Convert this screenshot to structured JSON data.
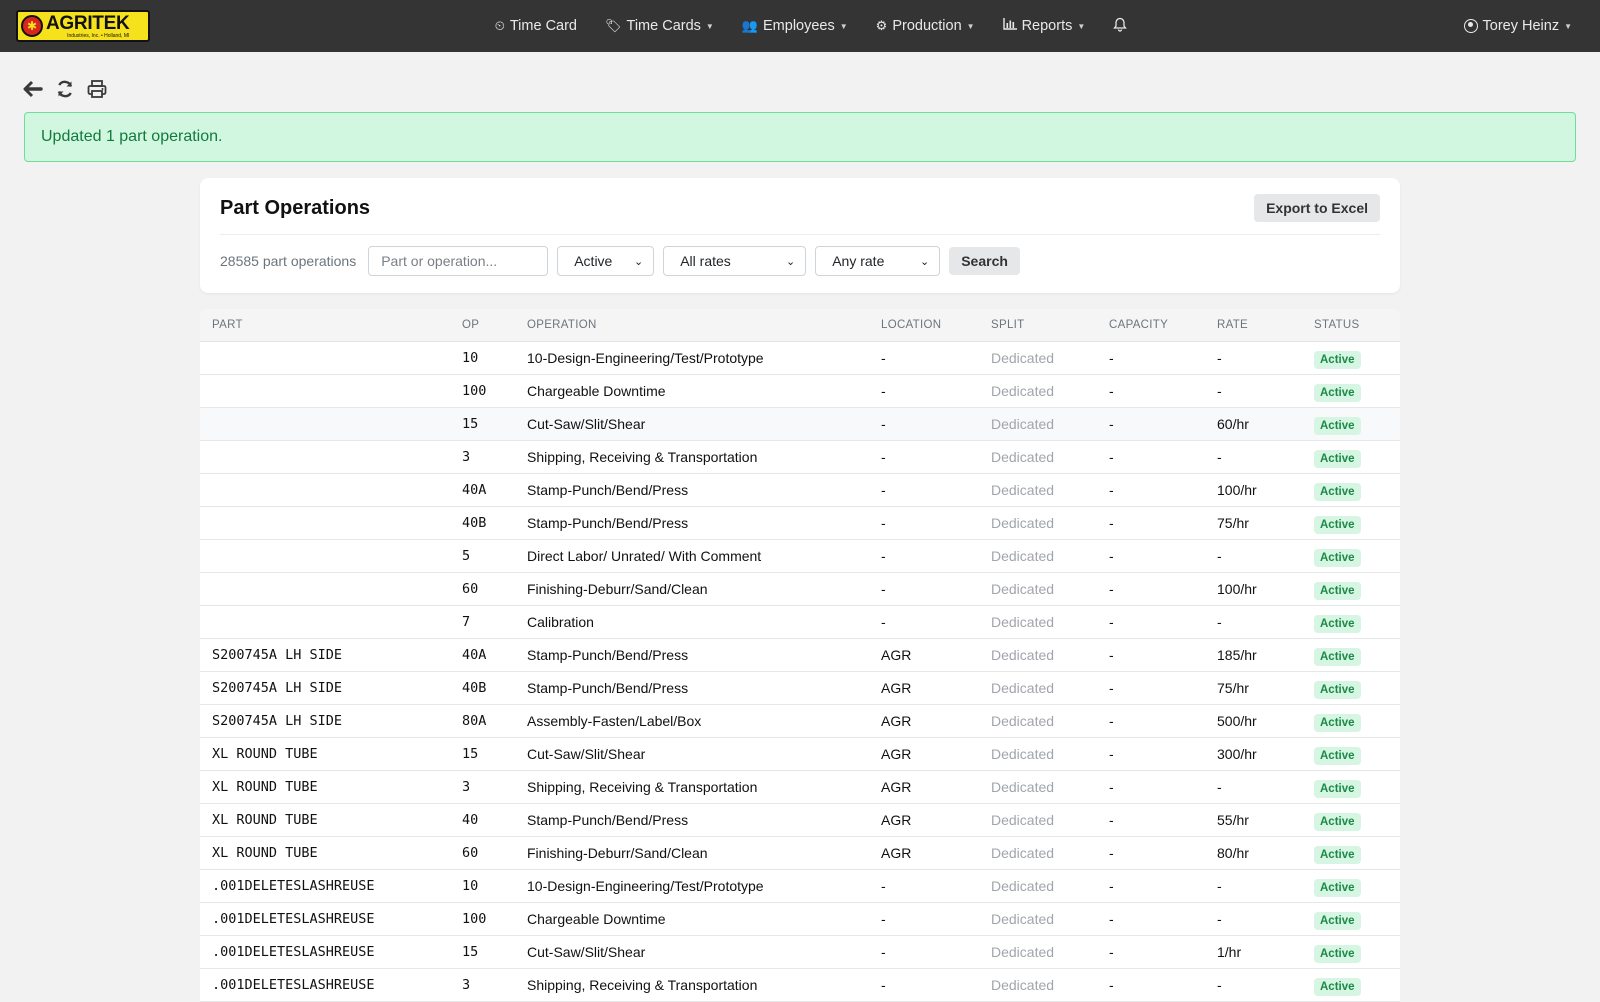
{
  "nav": {
    "logo_text": "AGRITEK",
    "logo_sub": "Industries, Inc. • Holland, MI",
    "items": [
      {
        "label": "Time Card",
        "icon": "clock-icon",
        "caret": false
      },
      {
        "label": "Time Cards",
        "icon": "tags-icon",
        "caret": true
      },
      {
        "label": "Employees",
        "icon": "users-icon",
        "caret": true
      },
      {
        "label": "Production",
        "icon": "cogs-icon",
        "caret": true
      },
      {
        "label": "Reports",
        "icon": "bar-chart-icon",
        "caret": true
      }
    ],
    "user": "Torey Heinz"
  },
  "toolbar": {
    "icons": [
      "back-arrow-icon",
      "refresh-icon",
      "print-icon"
    ]
  },
  "alert": {
    "message": "Updated 1 part operation."
  },
  "card": {
    "title": "Part Operations",
    "export_label": "Export to Excel",
    "count_text": "28585 part operations",
    "search_placeholder": "Part or operation...",
    "status_filter": "Active",
    "rates_filter": "All rates",
    "rate_filter": "Any rate",
    "search_label": "Search"
  },
  "table": {
    "headers": {
      "part": "PART",
      "op": "OP",
      "operation": "OPERATION",
      "location": "LOCATION",
      "split": "SPLIT",
      "capacity": "CAPACITY",
      "rate": "RATE",
      "status": "STATUS"
    },
    "rows": [
      {
        "part": "",
        "op": "10",
        "operation": "10-Design-Engineering/Test/Prototype",
        "location": "-",
        "split": "Dedicated",
        "capacity": "-",
        "rate": "-",
        "status": "Active"
      },
      {
        "part": "",
        "op": "100",
        "operation": "Chargeable Downtime",
        "location": "-",
        "split": "Dedicated",
        "capacity": "-",
        "rate": "-",
        "status": "Active"
      },
      {
        "part": "",
        "op": "15",
        "operation": "Cut-Saw/Slit/Shear",
        "location": "-",
        "split": "Dedicated",
        "capacity": "-",
        "rate": "60/hr",
        "status": "Active"
      },
      {
        "part": "",
        "op": "3",
        "operation": "Shipping, Receiving & Transportation",
        "location": "-",
        "split": "Dedicated",
        "capacity": "-",
        "rate": "-",
        "status": "Active"
      },
      {
        "part": "",
        "op": "40A",
        "operation": "Stamp-Punch/Bend/Press",
        "location": "-",
        "split": "Dedicated",
        "capacity": "-",
        "rate": "100/hr",
        "status": "Active"
      },
      {
        "part": "",
        "op": "40B",
        "operation": "Stamp-Punch/Bend/Press",
        "location": "-",
        "split": "Dedicated",
        "capacity": "-",
        "rate": "75/hr",
        "status": "Active"
      },
      {
        "part": "",
        "op": "5",
        "operation": "Direct Labor/ Unrated/ With Comment",
        "location": "-",
        "split": "Dedicated",
        "capacity": "-",
        "rate": "-",
        "status": "Active"
      },
      {
        "part": "",
        "op": "60",
        "operation": "Finishing-Deburr/Sand/Clean",
        "location": "-",
        "split": "Dedicated",
        "capacity": "-",
        "rate": "100/hr",
        "status": "Active"
      },
      {
        "part": "",
        "op": "7",
        "operation": "Calibration",
        "location": "-",
        "split": "Dedicated",
        "capacity": "-",
        "rate": "-",
        "status": "Active"
      },
      {
        "part": "S200745A LH SIDE",
        "op": "40A",
        "operation": "Stamp-Punch/Bend/Press",
        "location": "AGR",
        "split": "Dedicated",
        "capacity": "-",
        "rate": "185/hr",
        "status": "Active"
      },
      {
        "part": "S200745A LH SIDE",
        "op": "40B",
        "operation": "Stamp-Punch/Bend/Press",
        "location": "AGR",
        "split": "Dedicated",
        "capacity": "-",
        "rate": "75/hr",
        "status": "Active"
      },
      {
        "part": "S200745A LH SIDE",
        "op": "80A",
        "operation": "Assembly-Fasten/Label/Box",
        "location": "AGR",
        "split": "Dedicated",
        "capacity": "-",
        "rate": "500/hr",
        "status": "Active"
      },
      {
        "part": "XL ROUND TUBE",
        "op": "15",
        "operation": "Cut-Saw/Slit/Shear",
        "location": "AGR",
        "split": "Dedicated",
        "capacity": "-",
        "rate": "300/hr",
        "status": "Active"
      },
      {
        "part": "XL ROUND TUBE",
        "op": "3",
        "operation": "Shipping, Receiving & Transportation",
        "location": "AGR",
        "split": "Dedicated",
        "capacity": "-",
        "rate": "-",
        "status": "Active"
      },
      {
        "part": "XL ROUND TUBE",
        "op": "40",
        "operation": "Stamp-Punch/Bend/Press",
        "location": "AGR",
        "split": "Dedicated",
        "capacity": "-",
        "rate": "55/hr",
        "status": "Active"
      },
      {
        "part": "XL ROUND TUBE",
        "op": "60",
        "operation": "Finishing-Deburr/Sand/Clean",
        "location": "AGR",
        "split": "Dedicated",
        "capacity": "-",
        "rate": "80/hr",
        "status": "Active"
      },
      {
        "part": ".001DELETESLASHREUSE",
        "op": "10",
        "operation": "10-Design-Engineering/Test/Prototype",
        "location": "-",
        "split": "Dedicated",
        "capacity": "-",
        "rate": "-",
        "status": "Active"
      },
      {
        "part": ".001DELETESLASHREUSE",
        "op": "100",
        "operation": "Chargeable Downtime",
        "location": "-",
        "split": "Dedicated",
        "capacity": "-",
        "rate": "-",
        "status": "Active"
      },
      {
        "part": ".001DELETESLASHREUSE",
        "op": "15",
        "operation": "Cut-Saw/Slit/Shear",
        "location": "-",
        "split": "Dedicated",
        "capacity": "-",
        "rate": "1/hr",
        "status": "Active"
      },
      {
        "part": ".001DELETESLASHREUSE",
        "op": "3",
        "operation": "Shipping, Receiving & Transportation",
        "location": "-",
        "split": "Dedicated",
        "capacity": "-",
        "rate": "-",
        "status": "Active"
      }
    ]
  }
}
